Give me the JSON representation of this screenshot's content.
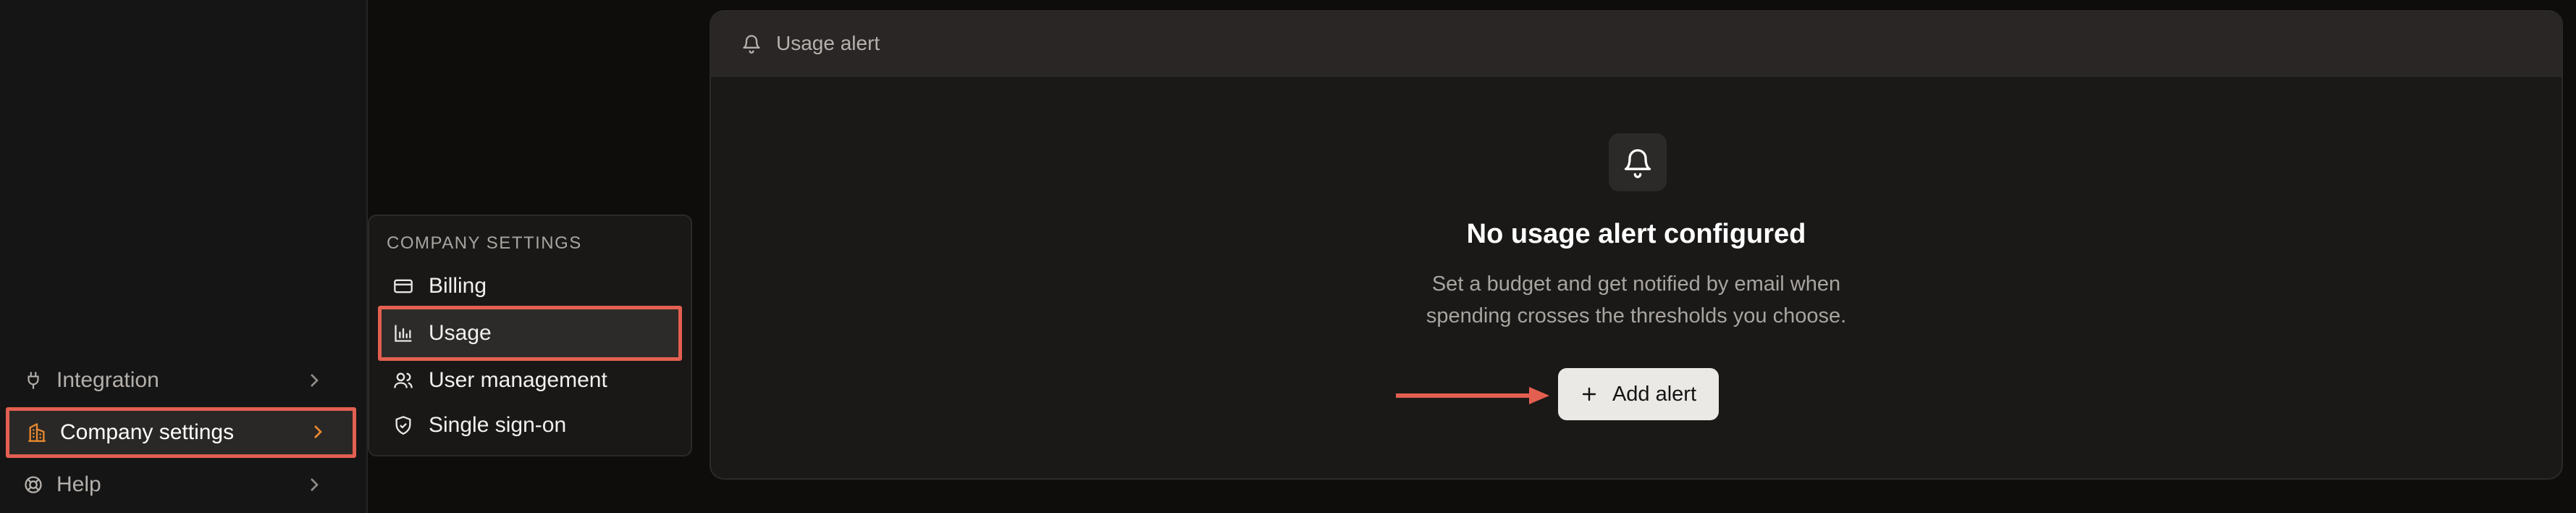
{
  "sidebar": {
    "items": [
      {
        "label": "Integration",
        "icon": "plug-icon"
      },
      {
        "label": "Company settings",
        "icon": "building-icon",
        "active": true
      },
      {
        "label": "Help",
        "icon": "lifebuoy-icon"
      }
    ]
  },
  "submenu": {
    "heading": "COMPANY SETTINGS",
    "items": [
      {
        "label": "Billing",
        "icon": "credit-card-icon"
      },
      {
        "label": "Usage",
        "icon": "bar-chart-icon",
        "selected": true
      },
      {
        "label": "User management",
        "icon": "users-icon"
      },
      {
        "label": "Single sign-on",
        "icon": "shield-check-icon"
      }
    ]
  },
  "panel": {
    "title": "Usage alert",
    "empty_state": {
      "title": "No usage alert configured",
      "description_line1": "Set a budget and get notified by email when",
      "description_line2": "spending crosses the thresholds you choose.",
      "button_label": "Add alert"
    }
  },
  "colors": {
    "highlight": "#e35f50",
    "accent_orange": "#e8892f",
    "background": "#0e0d0c"
  }
}
